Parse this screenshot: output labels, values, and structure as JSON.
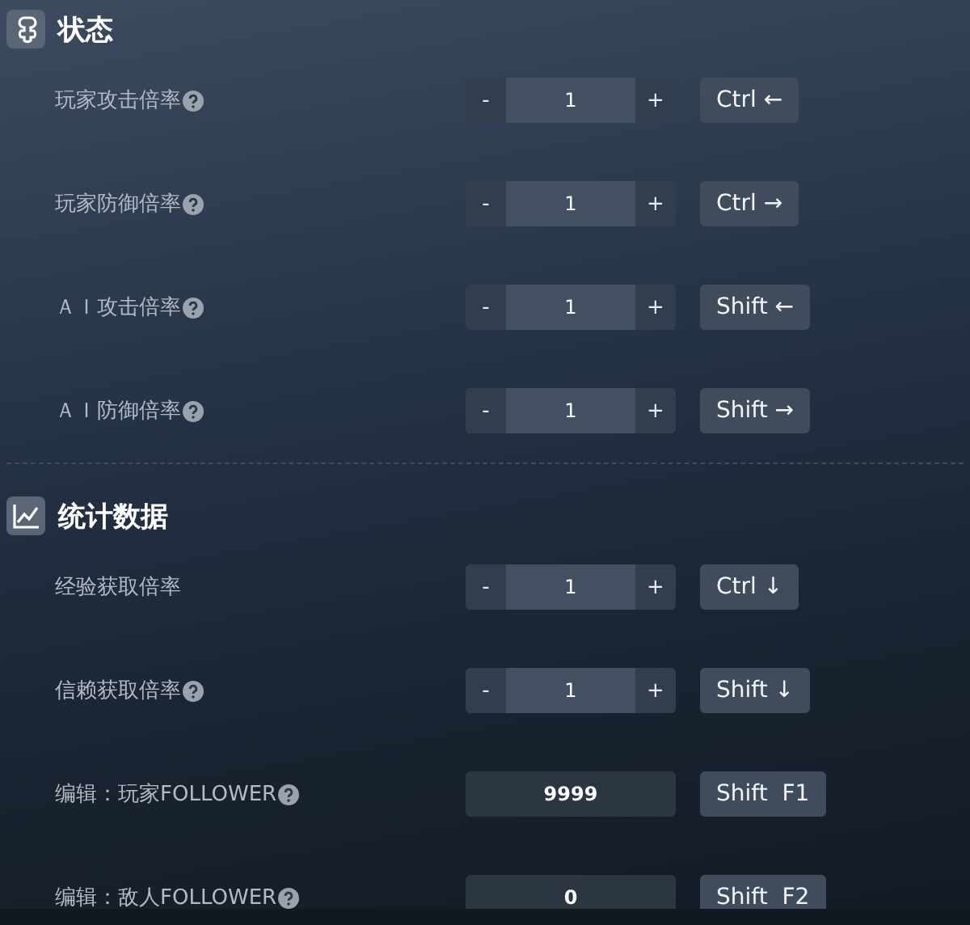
{
  "sections": [
    {
      "title": "状态",
      "rows": [
        {
          "label": "玩家攻击倍率",
          "help": true,
          "control": {
            "kind": "stepper",
            "minus": "-",
            "value": "1",
            "plus": "+"
          },
          "hotkey": "Ctrl ←"
        },
        {
          "label": "玩家防御倍率",
          "help": true,
          "control": {
            "kind": "stepper",
            "minus": "-",
            "value": "1",
            "plus": "+"
          },
          "hotkey": "Ctrl →"
        },
        {
          "label": "ＡＩ攻击倍率",
          "help": true,
          "control": {
            "kind": "stepper",
            "minus": "-",
            "value": "1",
            "plus": "+"
          },
          "hotkey": "Shift ←"
        },
        {
          "label": "ＡＩ防御倍率",
          "help": true,
          "control": {
            "kind": "stepper",
            "minus": "-",
            "value": "1",
            "plus": "+"
          },
          "hotkey": "Shift →"
        }
      ]
    },
    {
      "title": "统计数据",
      "rows": [
        {
          "label": "经验获取倍率",
          "help": false,
          "control": {
            "kind": "stepper",
            "minus": "-",
            "value": "1",
            "plus": "+"
          },
          "hotkey": "Ctrl ↓"
        },
        {
          "label": "信赖获取倍率",
          "help": true,
          "control": {
            "kind": "stepper",
            "minus": "-",
            "value": "1",
            "plus": "+"
          },
          "hotkey": "Shift ↓"
        },
        {
          "label": "编辑：玩家FOLLOWER",
          "help": true,
          "control": {
            "kind": "field",
            "value": "9999"
          },
          "hotkey": "Shift  F1"
        },
        {
          "label": "编辑：敌人FOLLOWER",
          "help": true,
          "control": {
            "kind": "field",
            "value": "0"
          },
          "hotkey": "Shift  F2"
        }
      ]
    }
  ]
}
